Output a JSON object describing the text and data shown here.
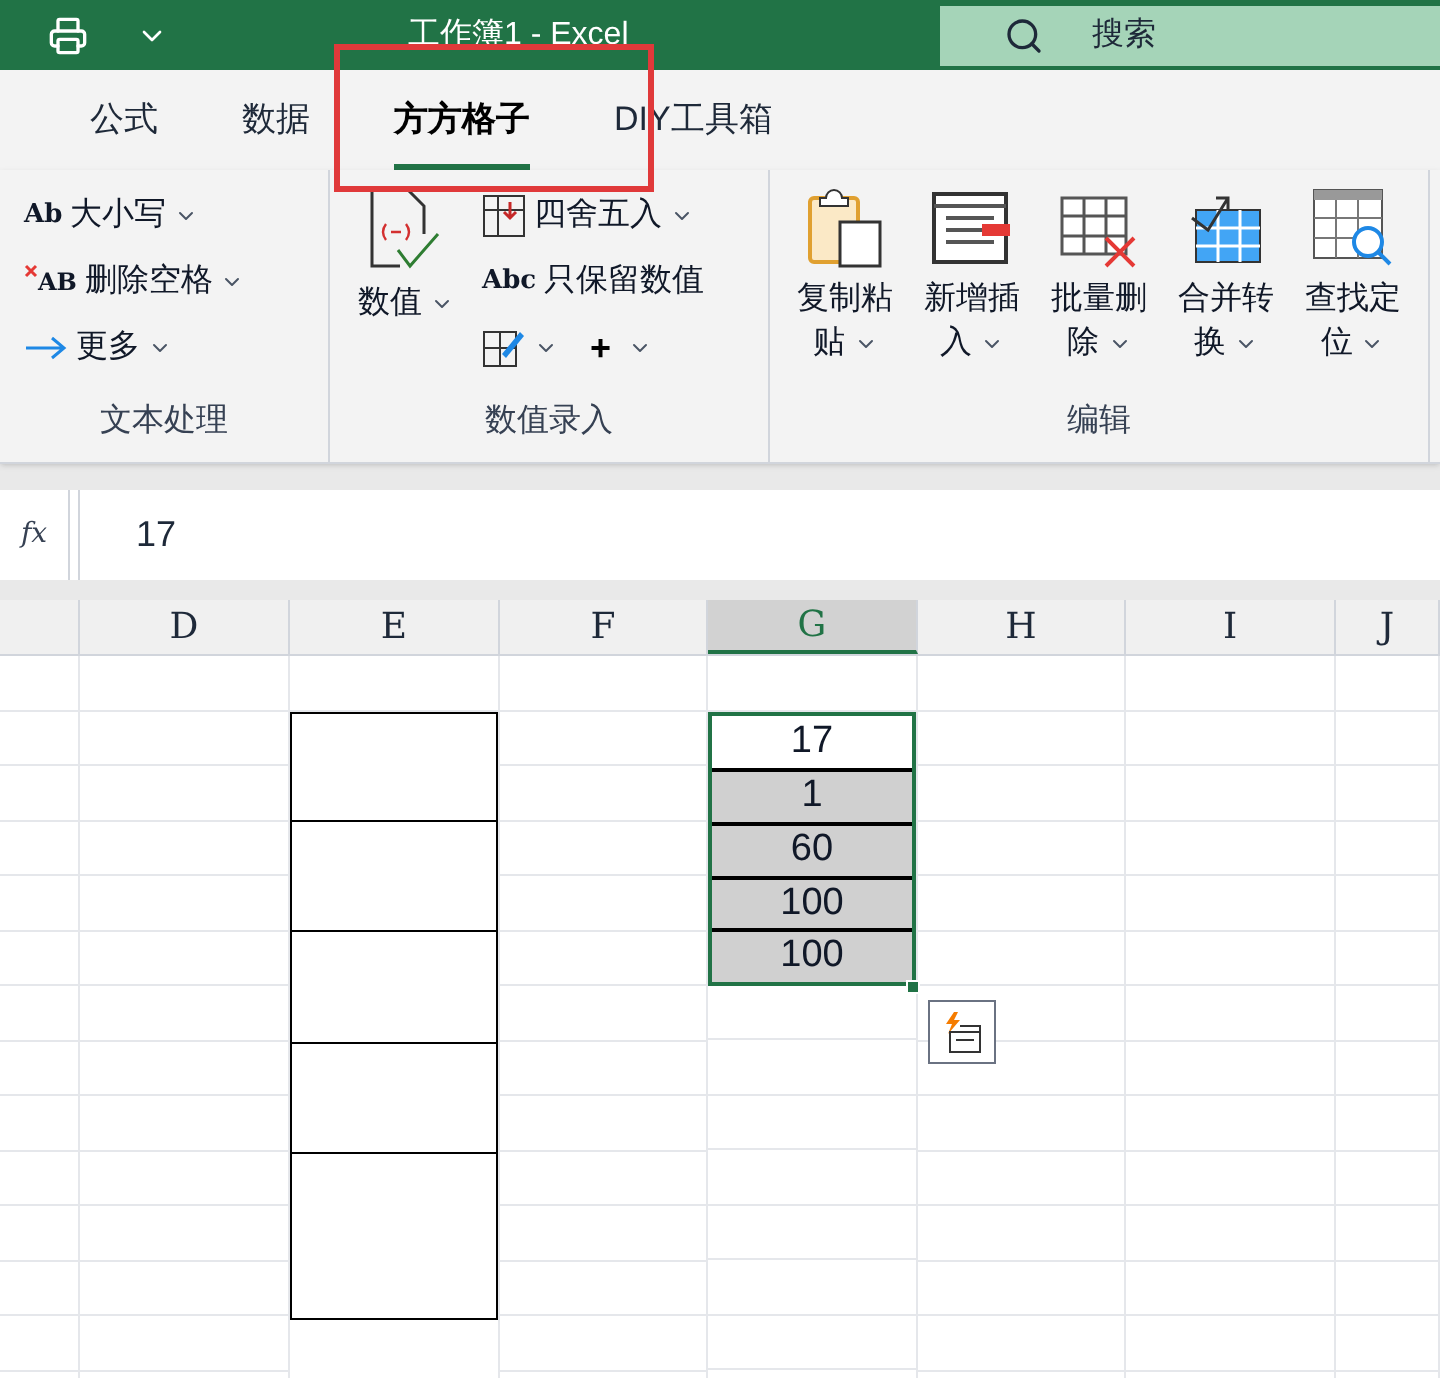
{
  "window": {
    "title": "工作簿1 - Excel"
  },
  "search": {
    "placeholder": "搜索"
  },
  "tabs": [
    {
      "label": "公式",
      "selected": false
    },
    {
      "label": "数据",
      "selected": false
    },
    {
      "label": "方方格子",
      "selected": true
    },
    {
      "label": "DIY工具箱",
      "selected": false
    }
  ],
  "ribbon": {
    "groups": [
      {
        "label": "文本处理",
        "items": [
          {
            "kind": "small",
            "icon_text": "Ab",
            "label": "大小写",
            "dropdown": true
          },
          {
            "kind": "small",
            "icon_text": "AB",
            "label": "删除空格",
            "dropdown": true
          },
          {
            "kind": "small",
            "label": "更多",
            "dropdown": true
          }
        ]
      },
      {
        "label": "数值录入",
        "items": [
          {
            "kind": "large",
            "label": "数值",
            "dropdown": true
          },
          {
            "kind": "small",
            "label": "四舍五入",
            "dropdown": true
          },
          {
            "kind": "small",
            "icon_text": "Abc",
            "label": "只保留数值",
            "dropdown": false
          },
          {
            "kind": "pair",
            "dropdown": true,
            "second": "+",
            "second_dropdown": true
          }
        ]
      },
      {
        "label": "编辑",
        "items": [
          {
            "kind": "large",
            "label": "复制粘贴",
            "dropdown": true
          },
          {
            "kind": "large",
            "label": "新增插入",
            "dropdown": true
          },
          {
            "kind": "large",
            "label": "批量删除",
            "dropdown": true
          },
          {
            "kind": "large",
            "label": "合并转换",
            "dropdown": true
          },
          {
            "kind": "large",
            "label": "查找定位",
            "dropdown": true
          }
        ]
      }
    ]
  },
  "formula_bar": {
    "fx": "fx",
    "value": "17"
  },
  "columns": [
    {
      "letter": "D",
      "selected": false
    },
    {
      "letter": "E",
      "selected": false
    },
    {
      "letter": "F",
      "selected": false
    },
    {
      "letter": "G",
      "selected": true
    },
    {
      "letter": "H",
      "selected": false
    },
    {
      "letter": "I",
      "selected": false
    },
    {
      "letter": "J",
      "selected": false
    }
  ],
  "cells_g": [
    {
      "value": "17",
      "selected": false
    },
    {
      "value": "1",
      "selected": true
    },
    {
      "value": "60",
      "selected": true
    },
    {
      "value": "100",
      "selected": true
    },
    {
      "value": "100",
      "selected": true
    }
  ]
}
